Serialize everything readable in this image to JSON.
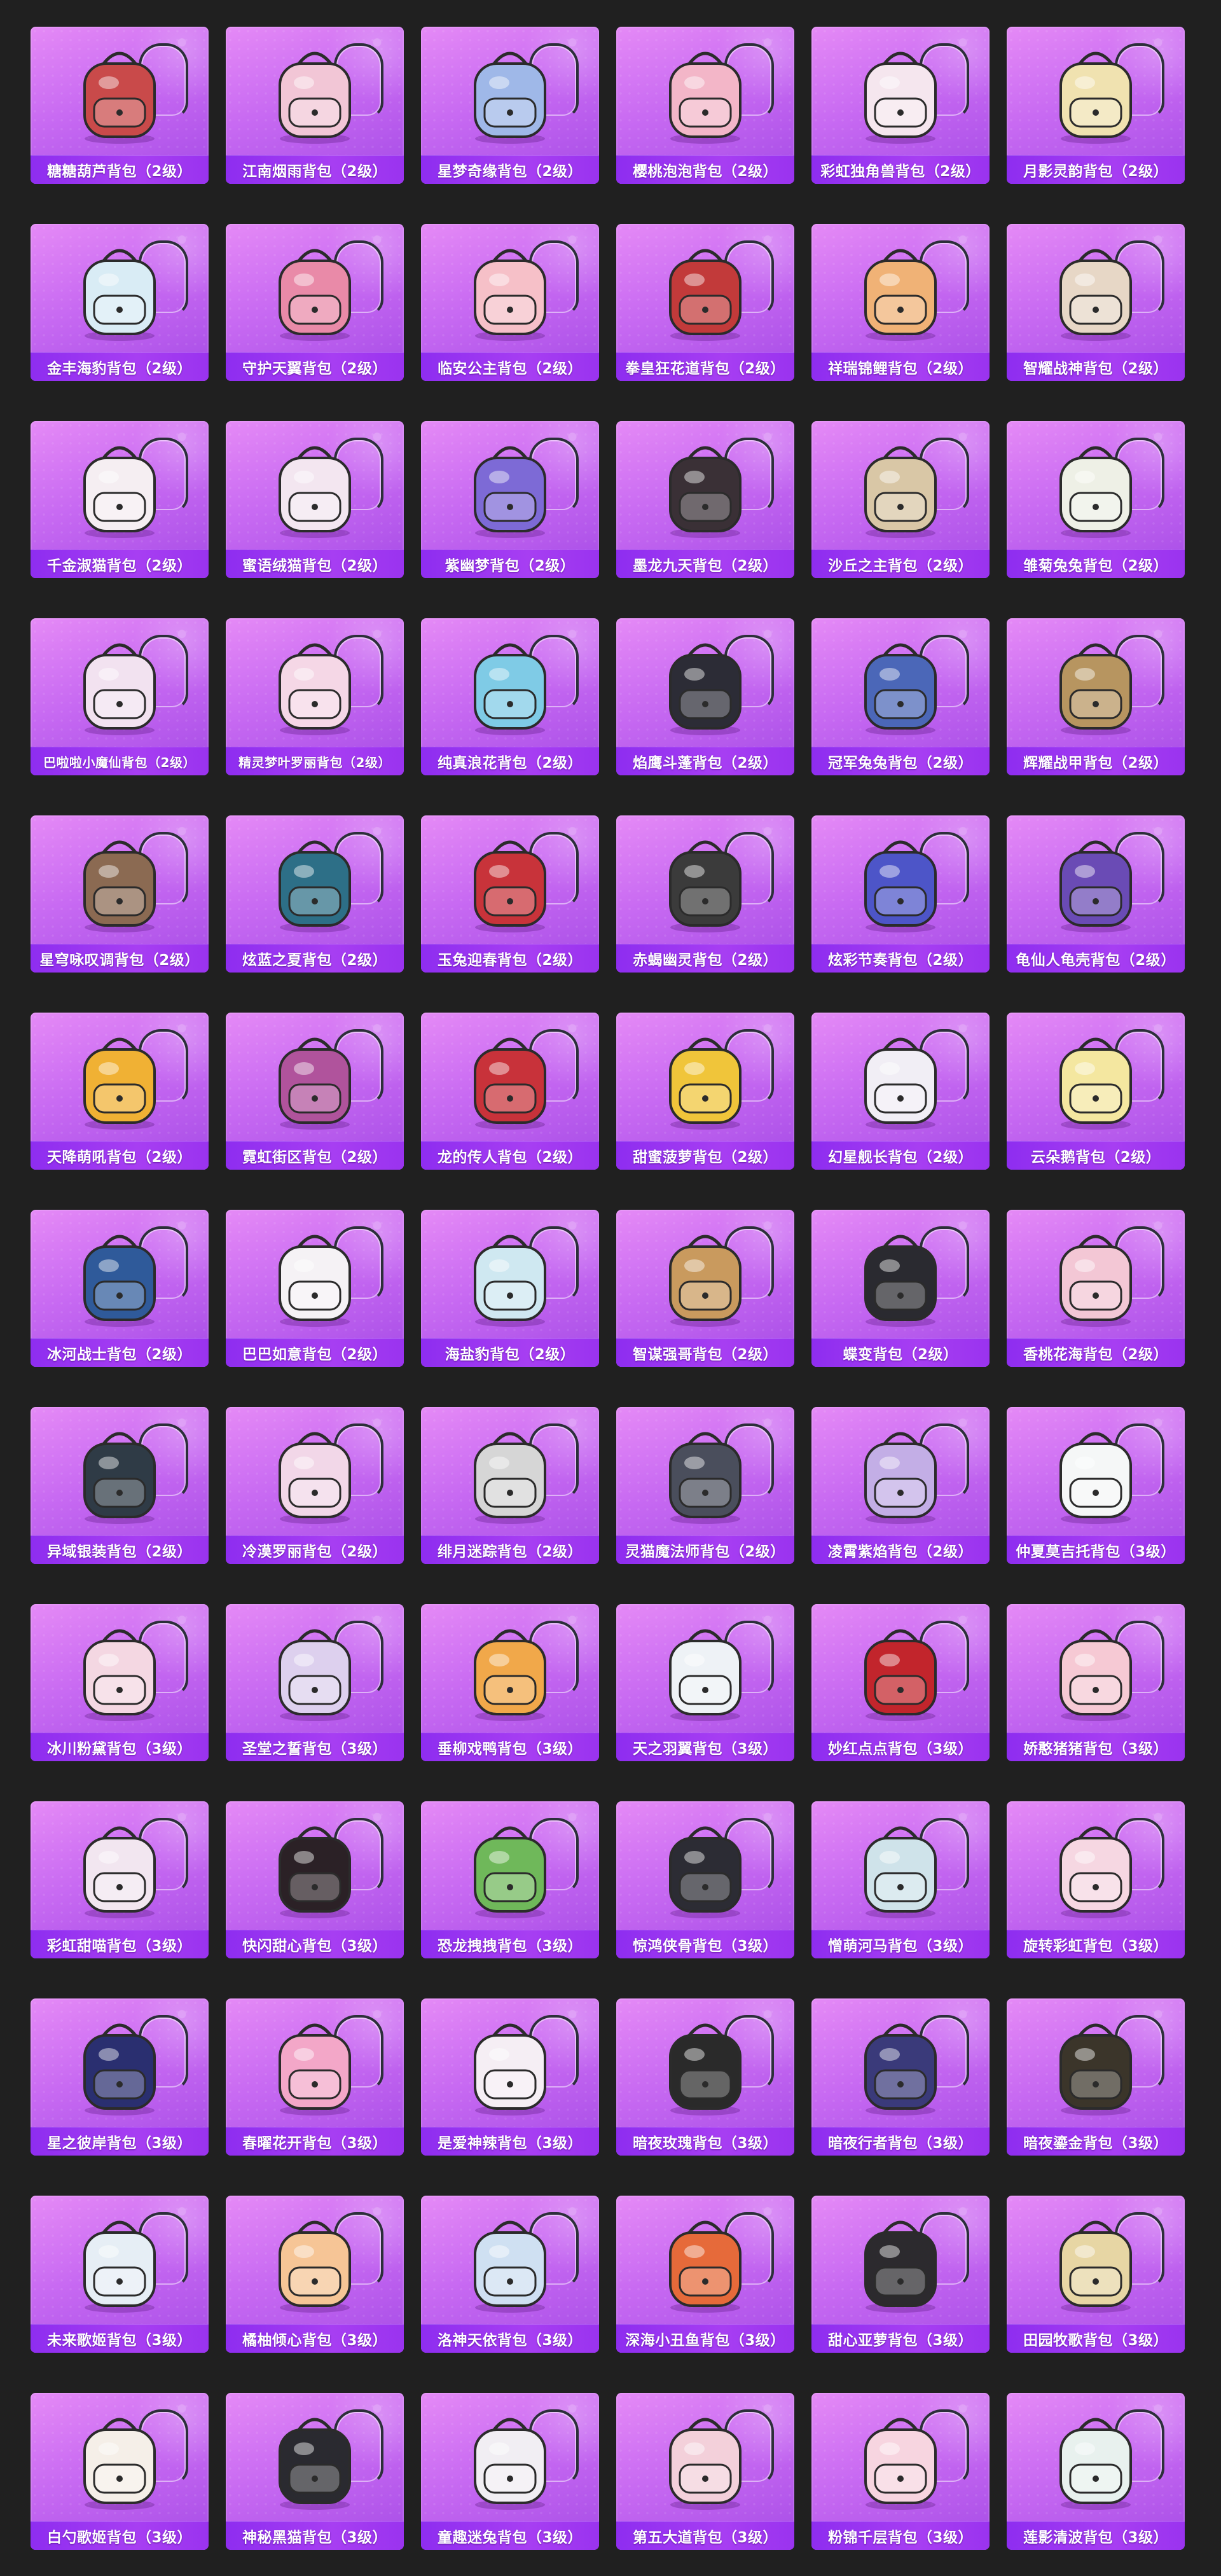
{
  "items": [
    {
      "label": "糖糖葫芦背包（2级）",
      "color": "#c94a4a"
    },
    {
      "label": "江南烟雨背包（2级）",
      "color": "#f2c6d6"
    },
    {
      "label": "星梦奇缘背包（2级）",
      "color": "#9fb8e8"
    },
    {
      "label": "樱桃泡泡背包（2级）",
      "color": "#f3b6c8"
    },
    {
      "label": "彩虹独角兽背包（2级）",
      "color": "#f5e6ee"
    },
    {
      "label": "月影灵韵背包（2级）",
      "color": "#f0e2b0"
    },
    {
      "label": "金丰海豹背包（2级）",
      "color": "#d9ecf5"
    },
    {
      "label": "守护天翼背包（2级）",
      "color": "#e98aa8"
    },
    {
      "label": "临安公主背包（2级）",
      "color": "#f6c0c8"
    },
    {
      "label": "拳皇狂花道背包（2级）",
      "color": "#c23a3a"
    },
    {
      "label": "祥瑞锦鲤背包（2级）",
      "color": "#f0b276"
    },
    {
      "label": "智耀战神背包（2级）",
      "color": "#e7d7c6"
    },
    {
      "label": "千金淑猫背包（2级）",
      "color": "#f5eef2"
    },
    {
      "label": "蜜语绒猫背包（2级）",
      "color": "#f3e6f0"
    },
    {
      "label": "紫幽梦背包（2级）",
      "color": "#7d6ad6"
    },
    {
      "label": "墨龙九天背包（2级）",
      "color": "#3a3036"
    },
    {
      "label": "沙丘之主背包（2级）",
      "color": "#d9c7a6"
    },
    {
      "label": "雏菊兔兔背包（2级）",
      "color": "#eef0e6"
    },
    {
      "label": "巴啦啦小魔仙背包（2级）",
      "color": "#f2e2f0",
      "small": true
    },
    {
      "label": "精灵梦叶罗丽背包（2级）",
      "color": "#f5d7e6",
      "small": true
    },
    {
      "label": "纯真浪花背包（2级）",
      "color": "#7fcbe6"
    },
    {
      "label": "焰鹰斗蓬背包（2级）",
      "color": "#2c2c36"
    },
    {
      "label": "冠军兔兔背包（2级）",
      "color": "#4b67b8"
    },
    {
      "label": "辉耀战甲背包（2级）",
      "color": "#b79560"
    },
    {
      "label": "星穹咏叹调背包（2级）",
      "color": "#8b6a52"
    },
    {
      "label": "炫蓝之夏背包（2级）",
      "color": "#2d6f87"
    },
    {
      "label": "玉兔迎春背包（2级）",
      "color": "#c8333a"
    },
    {
      "label": "赤蝎幽灵背包（2级）",
      "color": "#3b3b3b"
    },
    {
      "label": "炫彩节奏背包（2级）",
      "color": "#4d55c8"
    },
    {
      "label": "龟仙人龟壳背包（2级）",
      "color": "#6a4bb5"
    },
    {
      "label": "天降萌吼背包（2级）",
      "color": "#f0b134"
    },
    {
      "label": "霓虹街区背包（2级）",
      "color": "#b0539c"
    },
    {
      "label": "龙的传人背包（2级）",
      "color": "#c8323a"
    },
    {
      "label": "甜蜜菠萝背包（2级）",
      "color": "#f0c53a"
    },
    {
      "label": "幻星舰长背包（2级）",
      "color": "#f1eef5"
    },
    {
      "label": "云朵鹅背包（2级）",
      "color": "#f4e7a0"
    },
    {
      "label": "冰河战士背包（2级）",
      "color": "#2f5a9a"
    },
    {
      "label": "巴巴如意背包（2级）",
      "color": "#f5f2f5"
    },
    {
      "label": "海盐豹背包（2级）",
      "color": "#cfe8f1"
    },
    {
      "label": "智谋强哥背包（2级）",
      "color": "#c99a5e"
    },
    {
      "label": "蝶变背包（2级）",
      "color": "#2a2a30"
    },
    {
      "label": "香桃花海背包（2级）",
      "color": "#f3c7d5"
    },
    {
      "label": "异域银装背包（2级）",
      "color": "#2f3b46"
    },
    {
      "label": "冷漠罗丽背包（2级）",
      "color": "#f2d7e8"
    },
    {
      "label": "绯月迷踪背包（2级）",
      "color": "#d6d6d6"
    },
    {
      "label": "灵猫魔法师背包（2级）",
      "color": "#4a4e5c"
    },
    {
      "label": "凌霄紫焰背包（2级）",
      "color": "#c3aee6"
    },
    {
      "label": "仲夏莫吉托背包（3级）",
      "color": "#f5f7f7"
    },
    {
      "label": "冰川粉黛背包（3级）",
      "color": "#f4d7e2"
    },
    {
      "label": "圣堂之誓背包（3级）",
      "color": "#ddd0ee"
    },
    {
      "label": "垂柳戏鸭背包（3级）",
      "color": "#f1a84a"
    },
    {
      "label": "天之羽翼背包（3级）",
      "color": "#eef2f6"
    },
    {
      "label": "妙红点点背包（3级）",
      "color": "#c2252c"
    },
    {
      "label": "娇憨猪猪背包（3级）",
      "color": "#f6c9d4"
    },
    {
      "label": "彩虹甜喵背包（3级）",
      "color": "#f2e6f0"
    },
    {
      "label": "快闪甜心背包（3级）",
      "color": "#2b2126"
    },
    {
      "label": "恐龙拽拽背包（3级）",
      "color": "#6fb85a"
    },
    {
      "label": "惊鸿侠骨背包（3级）",
      "color": "#2c2c34"
    },
    {
      "label": "憎萌河马背包（3级）",
      "color": "#cfe3ea"
    },
    {
      "label": "旋转彩虹背包（3级）",
      "color": "#f6d7e2"
    },
    {
      "label": "星之彼岸背包（3级）",
      "color": "#2a2f70"
    },
    {
      "label": "春曜花开背包（3级）",
      "color": "#f3a7c8"
    },
    {
      "label": "是爱神辣背包（3级）",
      "color": "#f5eef4"
    },
    {
      "label": "暗夜玫瑰背包（3级）",
      "color": "#2a2a2a"
    },
    {
      "label": "暗夜行者背包（3级）",
      "color": "#3a3a7a"
    },
    {
      "label": "暗夜鎏金背包（3级）",
      "color": "#3b352a"
    },
    {
      "label": "未来歌姬背包（3级）",
      "color": "#e6eef5"
    },
    {
      "label": "橘柚倾心背包（3级）",
      "color": "#f6c596"
    },
    {
      "label": "洛神天依背包（3级）",
      "color": "#cfe0f2"
    },
    {
      "label": "深海小丑鱼背包（3级）",
      "color": "#e66a3a"
    },
    {
      "label": "甜心亚萝背包（3级）",
      "color": "#2c2a2e"
    },
    {
      "label": "田园牧歌背包（3级）",
      "color": "#e7d6a4"
    },
    {
      "label": "白勺歌姬背包（3级）",
      "color": "#f5efe8"
    },
    {
      "label": "神秘黑猫背包（3级）",
      "color": "#2a2a30"
    },
    {
      "label": "童趣迷兔背包（3级）",
      "color": "#f1eef3"
    },
    {
      "label": "第五大道背包（3级）",
      "color": "#f3d0da"
    },
    {
      "label": "粉锦千层背包（3级）",
      "color": "#f7d5e0"
    },
    {
      "label": "莲影清波背包（3级）",
      "color": "#e8f1ee"
    }
  ]
}
